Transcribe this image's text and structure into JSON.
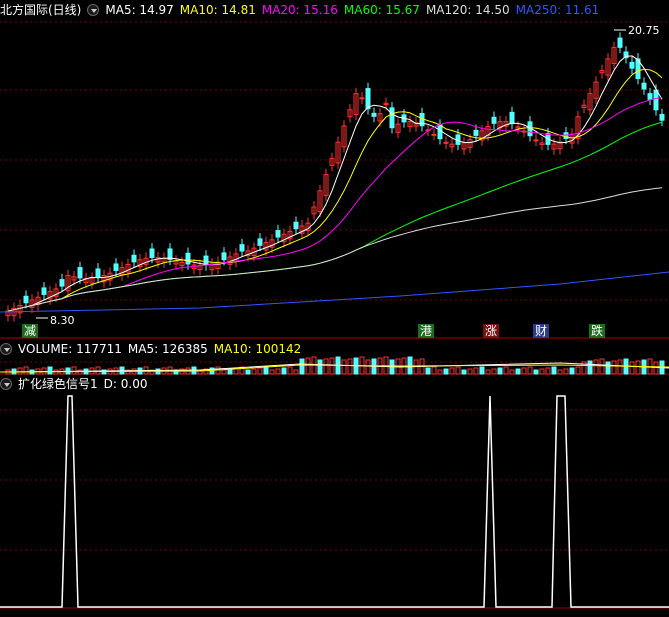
{
  "main_header": {
    "title": "北方国际(日线)",
    "items": [
      {
        "label": "MA5: 14.97",
        "color": "#ffffff"
      },
      {
        "label": "MA10: 14.81",
        "color": "#ffff00"
      },
      {
        "label": "MA20: 15.16",
        "color": "#ff00ff"
      },
      {
        "label": "MA60: 15.67",
        "color": "#00ff00"
      },
      {
        "label": "MA120: 14.50",
        "color": "#dddddd"
      },
      {
        "label": "MA250: 11.61",
        "color": "#3355ff"
      }
    ]
  },
  "price": {
    "high_label": "20.75",
    "low_label": "8.30"
  },
  "tags": [
    {
      "text": "减",
      "bg": "#1a6e1a",
      "fg": "#ffffff"
    },
    {
      "text": "港",
      "bg": "#1a6e1a",
      "fg": "#ffffff"
    },
    {
      "text": "涨",
      "bg": "#7a1010",
      "fg": "#ffffff"
    },
    {
      "text": "财",
      "bg": "#2a3a8a",
      "fg": "#ffffff"
    },
    {
      "text": "跌",
      "bg": "#1a6e1a",
      "fg": "#ffffff"
    }
  ],
  "volume_header": {
    "label": "VOLUME: 117711",
    "ma5": "MA5: 126385",
    "ma10": "MA10: 100142"
  },
  "indicator_header": {
    "name": "扩化绿色信号1",
    "value": "D: 0.00"
  },
  "colors": {
    "up": "#ff3030",
    "down": "#54ffff",
    "grid": "#7a0000"
  }
}
